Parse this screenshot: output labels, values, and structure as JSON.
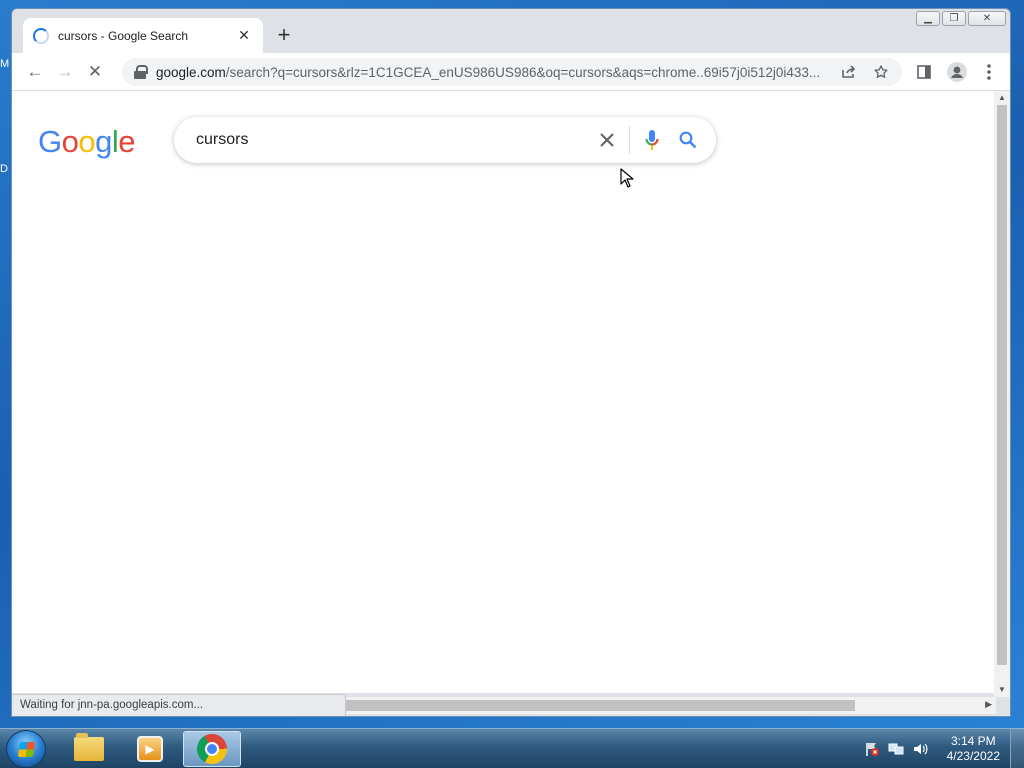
{
  "desktop": {
    "edge_letters": [
      "M",
      "D"
    ]
  },
  "browser": {
    "tab": {
      "title": "cursors - Google Search",
      "close_glyph": "✕"
    },
    "new_tab_glyph": "+",
    "window_buttons": {
      "minimize": "▁",
      "maximize": "❐",
      "close": "✕"
    },
    "nav": {
      "back": "←",
      "forward": "→",
      "stop": "✕"
    },
    "address": {
      "host": "google.com",
      "path": "/search?q=cursors&rlz=1C1GCEA_enUS986US986&oq=cursors&aqs=chrome..69i57j0i512j0i433..."
    },
    "status_text": "Waiting for jnn-pa.googleapis.com..."
  },
  "google": {
    "logo_letters": [
      {
        "ch": "G",
        "color": "#4285F4"
      },
      {
        "ch": "o",
        "color": "#EA4335"
      },
      {
        "ch": "o",
        "color": "#FBBC05"
      },
      {
        "ch": "g",
        "color": "#4285F4"
      },
      {
        "ch": "l",
        "color": "#34A853"
      },
      {
        "ch": "e",
        "color": "#EA4335"
      }
    ],
    "search_query": "cursors"
  },
  "taskbar": {
    "apps": [
      "file-explorer",
      "media-player",
      "chrome"
    ],
    "clock_time": "3:14 PM",
    "clock_date": "4/23/2022"
  }
}
